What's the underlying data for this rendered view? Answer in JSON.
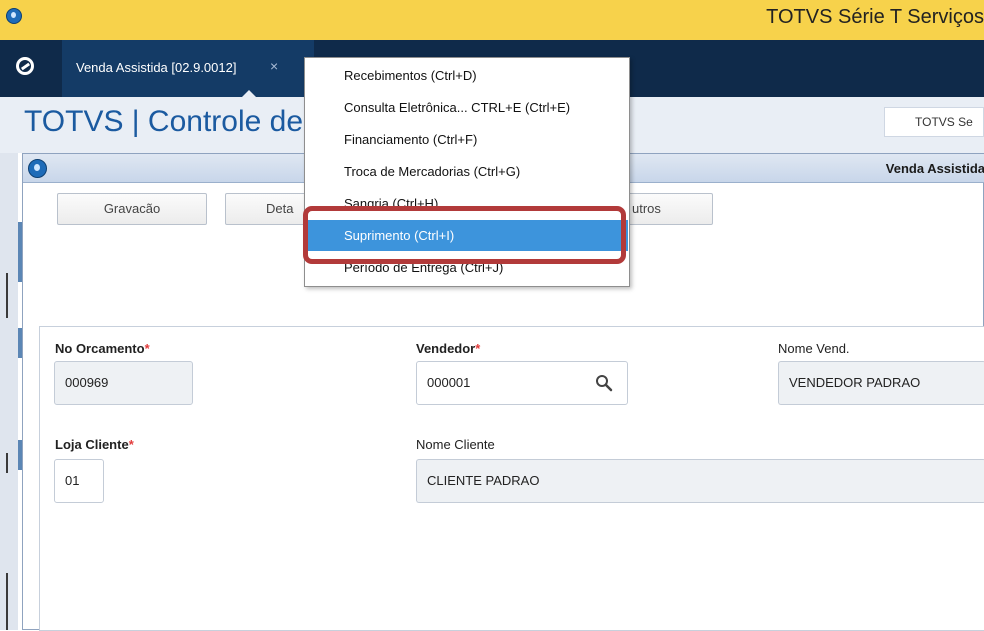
{
  "titlebar": {
    "title": "TOTVS Série T Serviços"
  },
  "tab": {
    "label": "Venda Assistida [02.9.0012]",
    "close_glyph": "×"
  },
  "header": {
    "brand": "TOTVS | Controle de",
    "right_label": "TOTVS Se"
  },
  "dialog": {
    "title": "Venda Assistida",
    "buttons": [
      {
        "label": "Gravacão"
      },
      {
        "label": "Deta"
      },
      {
        "label": "utros"
      }
    ]
  },
  "context_menu": {
    "items": [
      {
        "label": "Recebimentos (Ctrl+D)"
      },
      {
        "label": "Consulta Eletrônica... CTRL+E (Ctrl+E)"
      },
      {
        "label": "Financiamento (Ctrl+F)"
      },
      {
        "label": "Troca de Mercadorias (Ctrl+G)"
      },
      {
        "label": "Sangria (Ctrl+H)"
      },
      {
        "label": "Suprimento (Ctrl+I)"
      },
      {
        "label": "Período de Entrega (Ctrl+J)"
      }
    ],
    "highlighted_index": 5,
    "highlight_color": "#3d94dc",
    "annotation_color": "#b23a3a"
  },
  "form": {
    "orcamento": {
      "label": "No Orcamento",
      "required": "*",
      "value": "000969"
    },
    "vendedor": {
      "label": "Vendedor",
      "required": "*",
      "value": "000001"
    },
    "nome_vend": {
      "label": "Nome Vend.",
      "value": "VENDEDOR PADRAO"
    },
    "loja_cliente": {
      "label": "Loja Cliente",
      "required": "*",
      "value": "01"
    },
    "nome_cliente": {
      "label": "Nome Cliente",
      "value": "CLIENTE PADRAO"
    }
  },
  "colors": {
    "titlebar": "#f7d24b",
    "tabstrip": "#0f2a4a",
    "active_tab": "#143b66",
    "brand_blue": "#1b5aa0",
    "required": "#e23b3b"
  },
  "icons": [
    "app-icon",
    "totvs-logo-icon",
    "dialog-icon",
    "search-icon",
    "close-icon"
  ]
}
